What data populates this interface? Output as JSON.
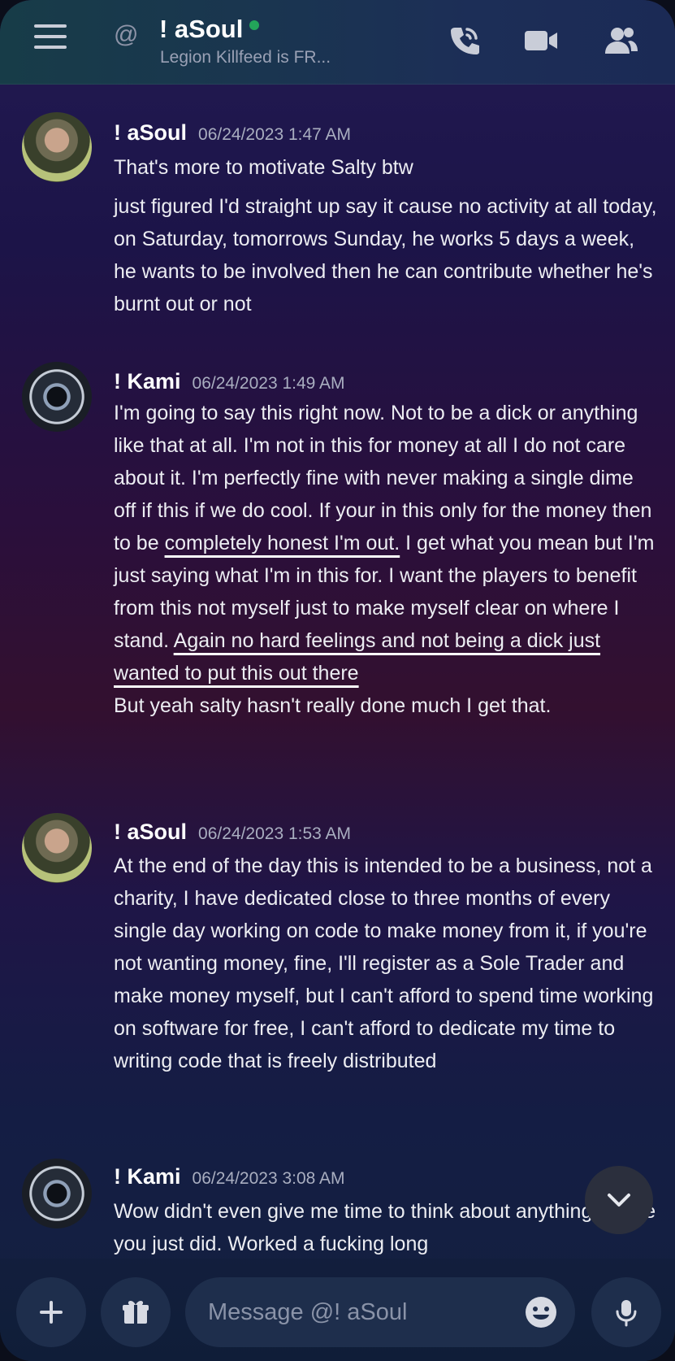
{
  "header": {
    "title": "! aSoul",
    "subtitle": "Legion Killfeed is FR...",
    "status_color": "#23a55a",
    "icons": [
      "menu-icon",
      "at-icon",
      "voice-call-icon",
      "video-call-icon",
      "members-icon"
    ]
  },
  "messages": [
    {
      "author": "! aSoul",
      "timestamp": "06/24/2023 1:47 AM",
      "paragraphs": [
        "That's more to motivate Salty btw",
        "just figured I'd straight up say it cause no activity at all today, on Saturday, tomorrows Sunday, he works 5 days a week, he wants to be involved then he can contribute whether he's burnt out or not"
      ]
    },
    {
      "author": "! Kami",
      "timestamp": "06/24/2023 1:49 AM",
      "segments": [
        "I'm going to say this right now. Not to be a dick or anything like that at all. I'm not in this for money at all I do not care about it. I'm perfectly fine with never making a single dime off if this if we do cool. If your in this only for the money then to be ",
        "completely honest I'm out.",
        " I get what you mean but I'm just saying what I'm in this for. I want the players to benefit from this not myself just to make myself clear on where I stand. ",
        "Again no hard feelings and not being a dick just wanted to put this out there"
      ],
      "followup": "But yeah salty hasn't really done much I get that."
    },
    {
      "author": "! aSoul",
      "timestamp": "06/24/2023 1:53 AM",
      "paragraphs": [
        "At the end of the day this is intended to be a business, not a charity, I have dedicated close to three months of every single day working on code to make money from it, if you're not wanting money, fine, I'll register as a Sole Trader and make money myself, but I can't afford to spend time working on software for free, I can't afford to dedicate my time to writing code that is freely distributed"
      ]
    },
    {
      "author": "! Kami",
      "timestamp": "06/24/2023 3:08 AM",
      "paragraphs": [
        "Wow didn't even give me time to think about anything before you just did. Worked a fucking long"
      ]
    }
  ],
  "composer": {
    "placeholder": "Message @! aSoul",
    "icons": [
      "plus-icon",
      "gift-icon",
      "emoji-icon",
      "microphone-icon"
    ]
  },
  "scroll_button_icon": "chevron-down-icon"
}
